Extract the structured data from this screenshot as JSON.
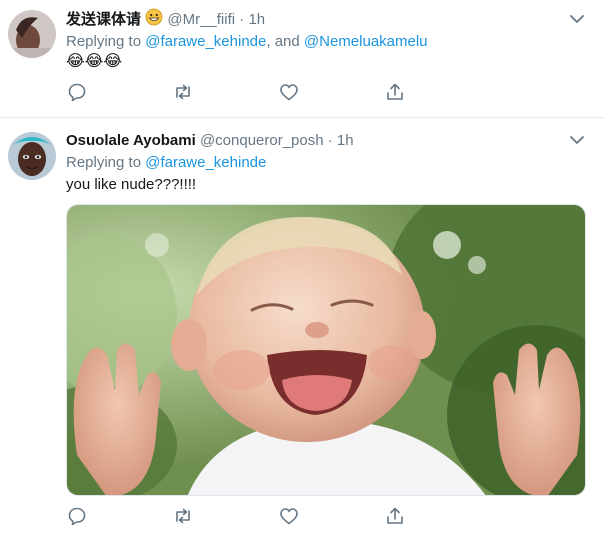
{
  "tweets": [
    {
      "name": "发送课体请",
      "handle": "@Mr__fiifi",
      "separator": "·",
      "time": "1h",
      "replying_prefix": "Replying to",
      "mention1": "@farawe_kehinde",
      "joiner": ", and",
      "mention2": "@Nemeluakamelu",
      "body_emoji": [
        "😂",
        "😂",
        "😂"
      ]
    },
    {
      "name": "Osuolale Ayobami",
      "handle": "@conqueror_posh",
      "separator": "·",
      "time": "1h",
      "replying_prefix": "Replying to",
      "mention1": "@farawe_kehinde",
      "body_text": "you like nude???!!!!",
      "media": "photo of a laughing baby with raised hands"
    }
  ],
  "actions": [
    "reply-icon",
    "retweet-icon",
    "like-icon",
    "share-icon"
  ],
  "colors": {
    "link": "#1b95e0",
    "muted": "#657786",
    "text": "#14171a",
    "divider": "#e6ecf0"
  }
}
